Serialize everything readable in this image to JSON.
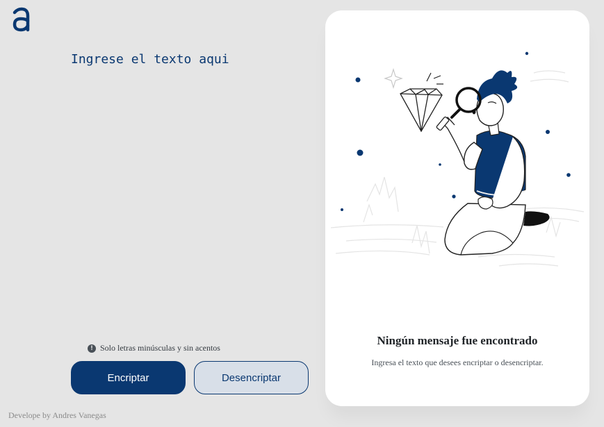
{
  "brand": {
    "logo_icon": "alura-a-logo-icon",
    "accent_color": "#0a3871"
  },
  "editor": {
    "placeholder": "Ingrese el texto aqui",
    "value": ""
  },
  "hint": {
    "icon": "exclamation-circle-icon",
    "text": "Solo letras minúsculas y sin acentos"
  },
  "actions": {
    "encrypt_label": "Encriptar",
    "decrypt_label": "Desencriptar"
  },
  "footer": {
    "text": "Develope by Andres Vanegas"
  },
  "output_panel": {
    "illustration": "person-with-magnifying-glass-illustration",
    "title": "Ningún mensaje fue encontrado",
    "subtitle": "Ingresa el texto que desees encriptar o desencriptar."
  }
}
